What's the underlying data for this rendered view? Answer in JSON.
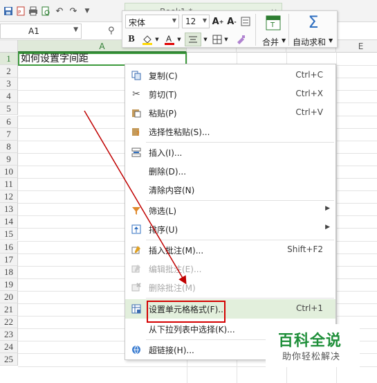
{
  "toolbar": {
    "icons": [
      "save-icon",
      "export-pdf-icon",
      "print-icon",
      "print-preview-icon",
      "undo-icon",
      "redo-icon",
      "customize-dropdown-icon"
    ],
    "tab_title": "Book1 *"
  },
  "formula_bar": {
    "name_box": "A1"
  },
  "columns": {
    "a": "A",
    "e": "E"
  },
  "rows": [
    "1",
    "2",
    "3",
    "4",
    "5",
    "6",
    "7",
    "8",
    "9",
    "10",
    "11",
    "12",
    "13",
    "14",
    "15",
    "16",
    "17",
    "18",
    "19",
    "20",
    "21",
    "22",
    "23",
    "24",
    "25"
  ],
  "cell_a1": "如何设置字间距",
  "mini_toolbar": {
    "font": "宋体",
    "size": "12",
    "merge_label": "合并",
    "autosum_label": "自动求和"
  },
  "context_menu": {
    "items": [
      {
        "label": "复制(C)",
        "shortcut": "Ctrl+C",
        "icon": "copy-icon"
      },
      {
        "label": "剪切(T)",
        "shortcut": "Ctrl+X",
        "icon": "scissors-icon"
      },
      {
        "label": "粘贴(P)",
        "shortcut": "Ctrl+V",
        "icon": "paste-icon"
      },
      {
        "label": "选择性粘贴(S)...",
        "shortcut": "",
        "icon": "paste-special-icon"
      },
      {
        "label": "插入(I)...",
        "shortcut": "",
        "icon": "insert-icon"
      },
      {
        "label": "删除(D)...",
        "shortcut": "",
        "icon": ""
      },
      {
        "label": "清除内容(N)",
        "shortcut": "",
        "icon": ""
      },
      {
        "label": "筛选(L)",
        "shortcut": "",
        "icon": "filter-icon"
      },
      {
        "label": "排序(U)",
        "shortcut": "",
        "icon": "sort-icon"
      },
      {
        "label": "插入批注(M)...",
        "shortcut": "Shift+F2",
        "icon": "insert-comment-icon"
      },
      {
        "label": "编辑批注(E)...",
        "shortcut": "",
        "icon": "edit-comment-icon"
      },
      {
        "label": "删除批注(M)",
        "shortcut": "",
        "icon": "delete-comment-icon"
      },
      {
        "label": "设置单元格格式(F)...",
        "shortcut": "Ctrl+1",
        "icon": "format-cells-icon"
      },
      {
        "label": "从下拉列表中选择(K)...",
        "shortcut": "",
        "icon": ""
      },
      {
        "label": "超链接(H)...",
        "shortcut": "",
        "icon": "hyperlink-icon"
      }
    ]
  },
  "watermark": {
    "title": "百科全说",
    "subtitle": "助你轻松解决"
  },
  "colors": {
    "accent_green": "#2e7d32",
    "highlight": "#e2efdc",
    "annotation_red": "#d40000"
  }
}
